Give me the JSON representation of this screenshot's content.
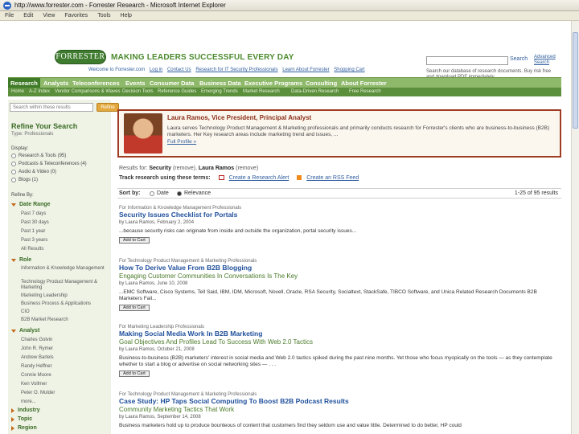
{
  "browser": {
    "title": "http://www.forrester.com - Forrester Research - Microsoft Internet Explorer",
    "menu": [
      "File",
      "Edit",
      "View",
      "Favorites",
      "Tools",
      "Help"
    ]
  },
  "header": {
    "logo": "FORRESTER",
    "tagline": "MAKING LEADERS SUCCESSFUL EVERY DAY",
    "top_links": [
      "Welcome to Forrester.com",
      "Log in",
      "Contact Us",
      "Research for IT Security Professionals",
      "Learn About Forrester",
      "Shopping Cart"
    ],
    "search_button": "Search",
    "advanced_search": "Advanced Search",
    "search_desc": "Search our database of research documents. Buy risk free and download PDF immediately."
  },
  "nav": {
    "tabs": [
      "Research",
      "Analysts",
      "Teleconferences",
      "Events",
      "Consumer Data",
      "Business Data",
      "Executive Programs",
      "Consulting",
      "About Forrester"
    ],
    "subnav": [
      "Home",
      "A-Z Index",
      "Vendor Comparisons & Waves",
      "Decision Tools",
      "Reference Guides",
      "Emerging Trends",
      "Market Research",
      "Data-Driven Research",
      "Free Research"
    ]
  },
  "sidebar": {
    "search_placeholder": "Search within these results",
    "refine_button": "Refine",
    "title": "Refine Your Search",
    "subtitle": "Type: Professionals",
    "display_label": "Display:",
    "display_options": [
      "Research & Tools (95)",
      "Podcasts & Teleconferences (4)",
      "Audio & Video (0)",
      "Blogs (1)"
    ],
    "refine_by": "Refine By:",
    "date_range": {
      "head": "Date Range",
      "items": [
        "Past 7 days",
        "Past 30 days",
        "Past 1 year",
        "Past 3 years",
        "All Results"
      ]
    },
    "role": {
      "head": "Role",
      "items": [
        "Information & Knowledge Management",
        "Technology Product Management & Marketing",
        "Marketing Leadership",
        "Business Process & Applications",
        "CIO",
        "B2B Market Research"
      ]
    },
    "analyst": {
      "head": "Analyst",
      "items": [
        "Charles Golvin",
        "John R. Rymer",
        "Andrew Bartels",
        "Randy Heffner",
        "Connie Moore",
        "Ken Vollmer",
        "Peter O. Mulder",
        "more..."
      ]
    },
    "collapsed": [
      "Industry",
      "Topic",
      "Region"
    ]
  },
  "analyst_box": {
    "name": "Laura Ramos, Vice President, Principal Analyst",
    "bio": "Laura serves Technology Product Management & Marketing professionals and primarily conducts research for Forrester's clients who are business-to-business (B2B) marketers. Her Key research areas include marketing trend and issues, ...",
    "full_profile": "Full Profile »"
  },
  "results_header": {
    "results_for_label": "Results for:",
    "term1": "Security",
    "remove1": "(remove)",
    "term2": "Laura Ramos",
    "remove2": "(remove)",
    "track_label": "Track research using these terms:",
    "create_alert": "Create a Research Alert",
    "create_rss": "Create an RSS Feed"
  },
  "sort": {
    "label": "Sort by:",
    "options": [
      "Date",
      "Relevance"
    ],
    "count": "1-25 of 95 results"
  },
  "results": [
    {
      "category": "For Information & Knowledge Management Professionals",
      "title": "Security Issues Checklist for Portals",
      "subtitle": "",
      "meta": "by Laura Ramos, February 2, 2004",
      "snippet": "...because security risks can originate from inside and outside the organization, portal security issues...",
      "cart": "Add to Cart"
    },
    {
      "category": "For Technology Product Management & Marketing Professionals",
      "title": "How To Derive Value From B2B Blogging",
      "subtitle": "Engaging Customer Communities In Conversations Is The Key",
      "meta": "by Laura Ramos, June 10, 2008",
      "snippet": "...EMC Software, Cisco Systems, Tell Said, IBM, IDM, Microsoft, Novell, Oracle, RSA Security, Socialtext, StackSafe, TIBCO Software, and Unica Related Research Documents B2B Marketers Fail...",
      "cart": "Add to Cart"
    },
    {
      "category": "For Marketing Leadership Professionals",
      "title": "Making Social Media Work In B2B Marketing",
      "subtitle": "Goal Objectives And Profiles Lead To Success With Web 2.0 Tactics",
      "meta": "by Laura Ramos, October 21, 2008",
      "snippet": "Business-to-business (B2B) marketers' interest in social media and Web 2.0 tactics spiked during the past nine months. Yet those who focus myopically on the tools — as they contemplate whether to start a blog or advertise on social networking sites — . . .",
      "cart": "Add to Cart"
    },
    {
      "category": "For Technology Product Management & Marketing Professionals",
      "title": "Case Study: HP Taps Social Computing To Boost B2B Podcast Results",
      "subtitle": "Community Marketing Tactics That Work",
      "meta": "by Laura Ramos, September 14, 2008",
      "snippet": "Business marketers hold up to produce bounteous of content that customers find they seldom use and value little. Determined to do better, HP could",
      "cart": "Add to Cart"
    }
  ]
}
